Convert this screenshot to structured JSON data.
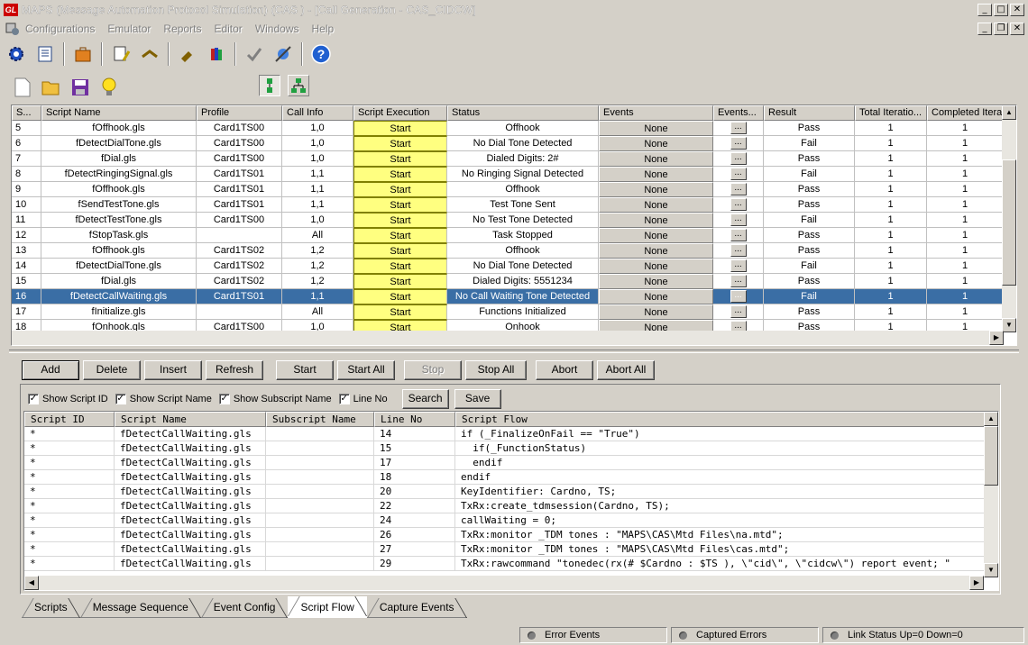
{
  "window": {
    "logo": "GL",
    "title": "MAPS (Message Automation Protocol Simulation)  (CAS  ) - [Call Generation - CAS_CIDCW]"
  },
  "menu": [
    "Configurations",
    "Emulator",
    "Reports",
    "Editor",
    "Windows",
    "Help"
  ],
  "grid": {
    "columns": [
      "S...",
      "Script Name",
      "Profile",
      "Call Info",
      "Script Execution",
      "Status",
      "Events",
      "Events...",
      "Result",
      "Total Iteratio...",
      "Completed Iterat"
    ],
    "rows": [
      {
        "s": "5",
        "name": "fOffhook.gls",
        "profile": "Card1TS00",
        "call": "1,0",
        "exec": "Start",
        "status": "Offhook",
        "events": "None",
        "dots": "...",
        "result": "Pass",
        "total": "1",
        "done": "1"
      },
      {
        "s": "6",
        "name": "fDetectDialTone.gls",
        "profile": "Card1TS00",
        "call": "1,0",
        "exec": "Start",
        "status": "No Dial Tone Detected",
        "events": "None",
        "dots": "...",
        "result": "Fail",
        "total": "1",
        "done": "1"
      },
      {
        "s": "7",
        "name": "fDial.gls",
        "profile": "Card1TS00",
        "call": "1,0",
        "exec": "Start",
        "status": "Dialed Digits: 2#",
        "events": "None",
        "dots": "...",
        "result": "Pass",
        "total": "1",
        "done": "1"
      },
      {
        "s": "8",
        "name": "fDetectRingingSignal.gls",
        "profile": "Card1TS01",
        "call": "1,1",
        "exec": "Start",
        "status": "No Ringing Signal Detected",
        "events": "None",
        "dots": "...",
        "result": "Fail",
        "total": "1",
        "done": "1"
      },
      {
        "s": "9",
        "name": "fOffhook.gls",
        "profile": "Card1TS01",
        "call": "1,1",
        "exec": "Start",
        "status": "Offhook",
        "events": "None",
        "dots": "...",
        "result": "Pass",
        "total": "1",
        "done": "1"
      },
      {
        "s": "10",
        "name": "fSendTestTone.gls",
        "profile": "Card1TS01",
        "call": "1,1",
        "exec": "Start",
        "status": "Test Tone Sent",
        "events": "None",
        "dots": "...",
        "result": "Pass",
        "total": "1",
        "done": "1"
      },
      {
        "s": "11",
        "name": "fDetectTestTone.gls",
        "profile": "Card1TS00",
        "call": "1,0",
        "exec": "Start",
        "status": "No Test Tone Detected",
        "events": "None",
        "dots": "...",
        "result": "Fail",
        "total": "1",
        "done": "1"
      },
      {
        "s": "12",
        "name": "fStopTask.gls",
        "profile": "",
        "call": "All",
        "exec": "Start",
        "status": "Task Stopped",
        "events": "None",
        "dots": "...",
        "result": "Pass",
        "total": "1",
        "done": "1"
      },
      {
        "s": "13",
        "name": "fOffhook.gls",
        "profile": "Card1TS02",
        "call": "1,2",
        "exec": "Start",
        "status": "Offhook",
        "events": "None",
        "dots": "...",
        "result": "Pass",
        "total": "1",
        "done": "1"
      },
      {
        "s": "14",
        "name": "fDetectDialTone.gls",
        "profile": "Card1TS02",
        "call": "1,2",
        "exec": "Start",
        "status": "No Dial Tone Detected",
        "events": "None",
        "dots": "...",
        "result": "Fail",
        "total": "1",
        "done": "1"
      },
      {
        "s": "15",
        "name": "fDial.gls",
        "profile": "Card1TS02",
        "call": "1,2",
        "exec": "Start",
        "status": "Dialed Digits: 5551234",
        "events": "None",
        "dots": "...",
        "result": "Pass",
        "total": "1",
        "done": "1"
      },
      {
        "s": "16",
        "name": "fDetectCallWaiting.gls",
        "profile": "Card1TS01",
        "call": "1,1",
        "exec": "Start",
        "status": "No Call Waiting Tone Detected",
        "events": "None",
        "dots": "...",
        "result": "Fail",
        "total": "1",
        "done": "1",
        "selected": true
      },
      {
        "s": "17",
        "name": "fInitialize.gls",
        "profile": "",
        "call": "All",
        "exec": "Start",
        "status": "Functions Initialized",
        "events": "None",
        "dots": "...",
        "result": "Pass",
        "total": "1",
        "done": "1"
      },
      {
        "s": "18",
        "name": "fOnhook.gls",
        "profile": "Card1TS00",
        "call": "1,0",
        "exec": "Start",
        "status": "Onhook",
        "events": "None",
        "dots": "...",
        "result": "Pass",
        "total": "1",
        "done": "1"
      }
    ]
  },
  "buttons": [
    "Add",
    "Delete",
    "Insert",
    "Refresh",
    "Start",
    "Start All",
    "Stop",
    "Stop All",
    "Abort",
    "Abort All"
  ],
  "options": {
    "show_script_id": "Show Script ID",
    "show_script_name": "Show Script Name",
    "show_subscript_name": "Show Subscript Name",
    "line_no": "Line No",
    "search": "Search",
    "save": "Save"
  },
  "flow": {
    "columns": [
      "Script ID",
      "Script Name",
      "Subscript Name",
      "Line No",
      "Script Flow"
    ],
    "rows": [
      {
        "id": "*",
        "name": "fDetectCallWaiting.gls",
        "sub": "",
        "line": "14",
        "flow": "if (_FinalizeOnFail == \"True\")"
      },
      {
        "id": "*",
        "name": "fDetectCallWaiting.gls",
        "sub": "",
        "line": "15",
        "flow": "  if(_FunctionStatus)"
      },
      {
        "id": "*",
        "name": "fDetectCallWaiting.gls",
        "sub": "",
        "line": "17",
        "flow": "  endif"
      },
      {
        "id": "*",
        "name": "fDetectCallWaiting.gls",
        "sub": "",
        "line": "18",
        "flow": "endif"
      },
      {
        "id": "*",
        "name": "fDetectCallWaiting.gls",
        "sub": "",
        "line": "20",
        "flow": "KeyIdentifier: Cardno, TS;"
      },
      {
        "id": "*",
        "name": "fDetectCallWaiting.gls",
        "sub": "",
        "line": "22",
        "flow": "TxRx:create_tdmsession(Cardno, TS);"
      },
      {
        "id": "*",
        "name": "fDetectCallWaiting.gls",
        "sub": "",
        "line": "24",
        "flow": "callWaiting = 0;"
      },
      {
        "id": "*",
        "name": "fDetectCallWaiting.gls",
        "sub": "",
        "line": "26",
        "flow": "TxRx:monitor _TDM tones : \"MAPS\\CAS\\Mtd Files\\na.mtd\";"
      },
      {
        "id": "*",
        "name": "fDetectCallWaiting.gls",
        "sub": "",
        "line": "27",
        "flow": "TxRx:monitor _TDM tones : \"MAPS\\CAS\\Mtd Files\\cas.mtd\";"
      },
      {
        "id": "*",
        "name": "fDetectCallWaiting.gls",
        "sub": "",
        "line": "29",
        "flow": "TxRx:rawcommand \"tonedec(rx(# $Cardno : $TS ), \\\"cid\\\", \\\"cidcw\\\") report event; \""
      }
    ]
  },
  "tabs": [
    "Scripts",
    "Message Sequence",
    "Event Config",
    "Script Flow",
    "Capture Events"
  ],
  "active_tab": "Script Flow",
  "status": {
    "error_events": "Error Events",
    "captured_errors": "Captured Errors",
    "link_status": "Link Status Up=0 Down=0"
  },
  "colors": {
    "selection": "#3a6ea5",
    "exec_bg": "#ffff80",
    "face": "#d4d0c8"
  }
}
